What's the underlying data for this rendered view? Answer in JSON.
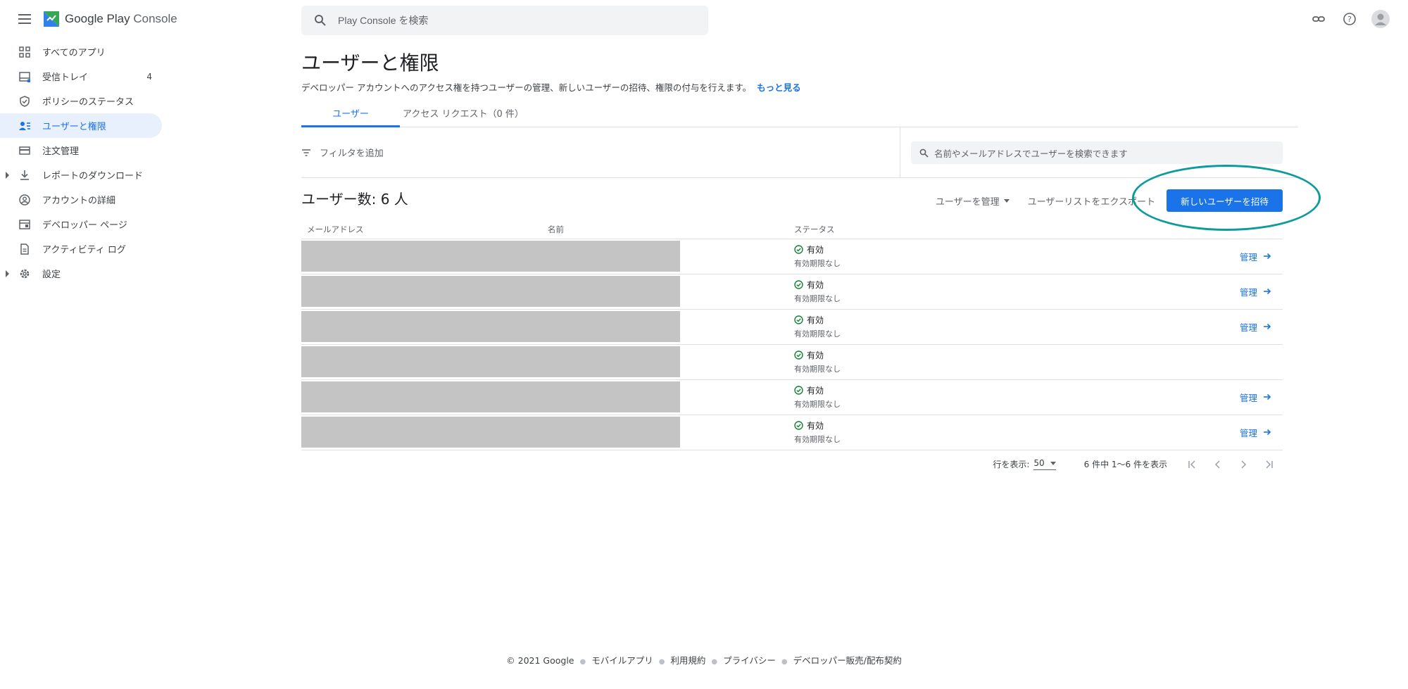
{
  "app": {
    "logo_google": "Google Play",
    "logo_console": "Console",
    "search_placeholder": "Play Console を検索"
  },
  "sidebar": {
    "items": [
      {
        "label": "すべてのアプリ",
        "icon": "grid-icon"
      },
      {
        "label": "受信トレイ",
        "icon": "inbox-icon",
        "badge": "4"
      },
      {
        "label": "ポリシーのステータス",
        "icon": "shield-icon"
      },
      {
        "label": "ユーザーと権限",
        "icon": "users-icon",
        "active": true
      },
      {
        "label": "注文管理",
        "icon": "credit-card-icon"
      },
      {
        "label": "レポートのダウンロード",
        "icon": "download-icon",
        "expandable": true
      },
      {
        "label": "アカウントの詳細",
        "icon": "account-icon"
      },
      {
        "label": "デベロッパー ページ",
        "icon": "web-page-icon"
      },
      {
        "label": "アクティビティ ログ",
        "icon": "document-icon"
      },
      {
        "label": "設定",
        "icon": "gear-icon",
        "expandable": true
      }
    ]
  },
  "page": {
    "title": "ユーザーと権限",
    "description": "デベロッパー アカウントへのアクセス権を持つユーザーの管理、新しいユーザーの招待、権限の付与を行えます。",
    "more_link": "もっと見る"
  },
  "tabs": [
    {
      "label": "ユーザー",
      "active": true
    },
    {
      "label": "アクセス リクエスト（0 件）"
    }
  ],
  "filter": {
    "add_label": "フィルタを追加",
    "search_placeholder": "名前やメールアドレスでユーザーを検索できます"
  },
  "users": {
    "count_label": "ユーザー数: 6 人",
    "manage_users": "ユーザーを管理",
    "export": "ユーザーリストをエクスポート",
    "invite": "新しいユーザーを招待",
    "columns": [
      "メールアドレス",
      "名前",
      "ステータス"
    ],
    "rows": [
      {
        "status": "有効",
        "expiry": "有効期限なし",
        "manage": "管理"
      },
      {
        "status": "有効",
        "expiry": "有効期限なし",
        "manage": "管理"
      },
      {
        "status": "有効",
        "expiry": "有効期限なし",
        "manage": "管理"
      },
      {
        "status": "有効",
        "expiry": "有効期限なし",
        "manage": ""
      },
      {
        "status": "有効",
        "expiry": "有効期限なし",
        "manage": "管理"
      },
      {
        "status": "有効",
        "expiry": "有効期限なし",
        "manage": "管理"
      }
    ]
  },
  "pager": {
    "rows_label": "行を表示:",
    "rows_value": "50",
    "range": "6 件中 1〜6 件を表示"
  },
  "footer": {
    "items": [
      "© 2021 Google",
      "モバイルアプリ",
      "利用規約",
      "プライバシー",
      "デベロッパー販売/配布契約"
    ]
  },
  "colors": {
    "accent": "#1a73e8",
    "highlight": "#0d9b9b",
    "status_ok": "#188038"
  }
}
